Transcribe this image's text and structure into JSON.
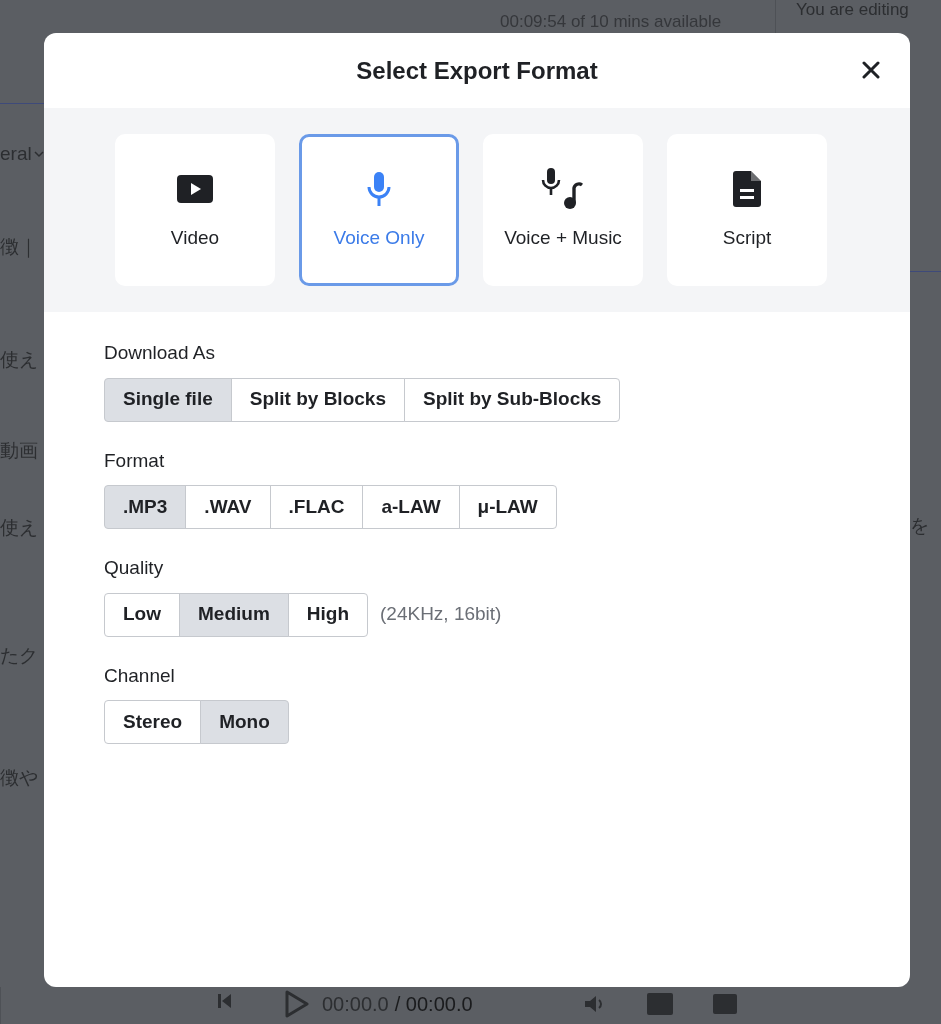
{
  "background": {
    "usage": "00:09:54 of 10 mins available",
    "editing": "You are editing",
    "left_fragments": [
      {
        "text": "eral",
        "kind": "dropdown"
      },
      {
        "text": "徴｜",
        "kind": "text"
      },
      {
        "text": "使え",
        "kind": "text"
      },
      {
        "text": "動画",
        "kind": "text"
      },
      {
        "text": "使え",
        "kind": "text"
      },
      {
        "text": "たク",
        "kind": "text"
      },
      {
        "text": "徴や",
        "kind": "text"
      }
    ],
    "right_fragments": [
      "を"
    ],
    "player": {
      "current": "00:00.0",
      "total": "/ 00:00.0"
    }
  },
  "dialog": {
    "title": "Select Export Format",
    "formats": [
      {
        "label": "Video",
        "kind": "video",
        "selected": false
      },
      {
        "label": "Voice Only",
        "kind": "voice",
        "selected": true
      },
      {
        "label": "Voice + Music",
        "kind": "music",
        "selected": false
      },
      {
        "label": "Script",
        "kind": "script",
        "selected": false
      }
    ],
    "options": [
      {
        "label": "Download As",
        "choices": [
          {
            "label": "Single file",
            "selected": true
          },
          {
            "label": "Split by Blocks",
            "selected": false
          },
          {
            "label": "Split by Sub-Blocks",
            "selected": false
          }
        ]
      },
      {
        "label": "Format",
        "choices": [
          {
            "label": ".MP3",
            "selected": true
          },
          {
            "label": ".WAV",
            "selected": false
          },
          {
            "label": ".FLAC",
            "selected": false
          },
          {
            "label": "a-LAW",
            "selected": false
          },
          {
            "label": "μ-LAW",
            "selected": false
          }
        ]
      },
      {
        "label": "Quality",
        "note": "(24KHz, 16bit)",
        "choices": [
          {
            "label": "Low",
            "selected": false
          },
          {
            "label": "Medium",
            "selected": true
          },
          {
            "label": "High",
            "selected": false
          }
        ]
      },
      {
        "label": "Channel",
        "choices": [
          {
            "label": "Stereo",
            "selected": false
          },
          {
            "label": "Mono",
            "selected": true
          }
        ]
      }
    ]
  }
}
